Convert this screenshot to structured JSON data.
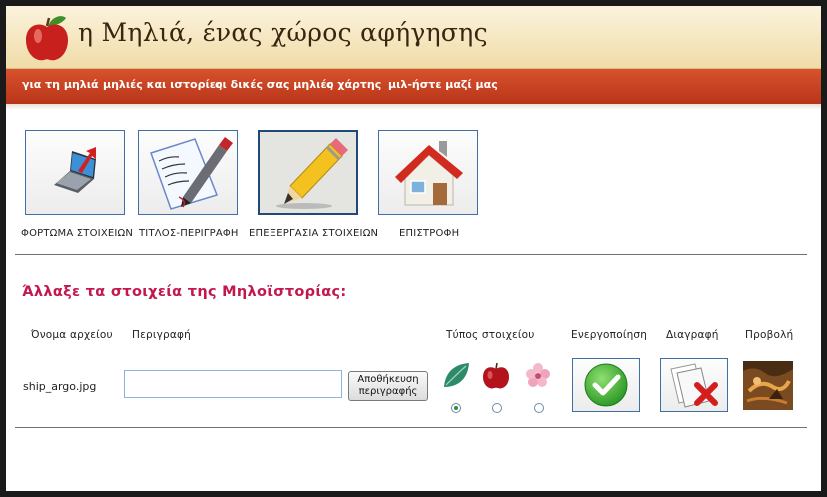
{
  "site": {
    "title": "η Μηλιά, ένας χώρος αφήγησης"
  },
  "nav": {
    "items": [
      {
        "label": "για τη μηλιά"
      },
      {
        "label": "μηλιές και ιστορίες"
      },
      {
        "label": "οι δικές σας μηλιές"
      },
      {
        "label": "ο χάρτης"
      },
      {
        "label": "μιλ-ήστε μαζί μας"
      }
    ]
  },
  "toolbar": {
    "upload_label": "ΦΟΡΤΩΜΑ ΣΤΟΙΧΕΙΩΝ",
    "title_label": "ΤΙΤΛΟΣ-ΠΕΡΙΓΡΑΦΗ",
    "edit_label": "ΕΠΕΞΕΡΓΑΣΙΑ ΣΤΟΙΧΕΙΩΝ",
    "back_label": "ΕΠΙΣΤΡΟΦΗ"
  },
  "section": {
    "title": "Άλλαξε τα στοιχεία της Μηλοϊστορίας:"
  },
  "table": {
    "headers": {
      "filename": "Όνομα αρχείου",
      "description": "Περιγραφή",
      "type": "Τύπος στοιχείου",
      "activate": "Ενεργοποίηση",
      "delete": "Διαγραφή",
      "view": "Προβολή"
    },
    "row": {
      "filename": "ship_argo.jpg",
      "description_value": "",
      "save_line1": "Αποθήκευση",
      "save_line2": "περιγραφής",
      "selected_type": "leaf"
    }
  },
  "colors": {
    "nav_red": "#c8401f",
    "title_pink": "#c2184e",
    "header_cream": "#f5e6bd"
  }
}
